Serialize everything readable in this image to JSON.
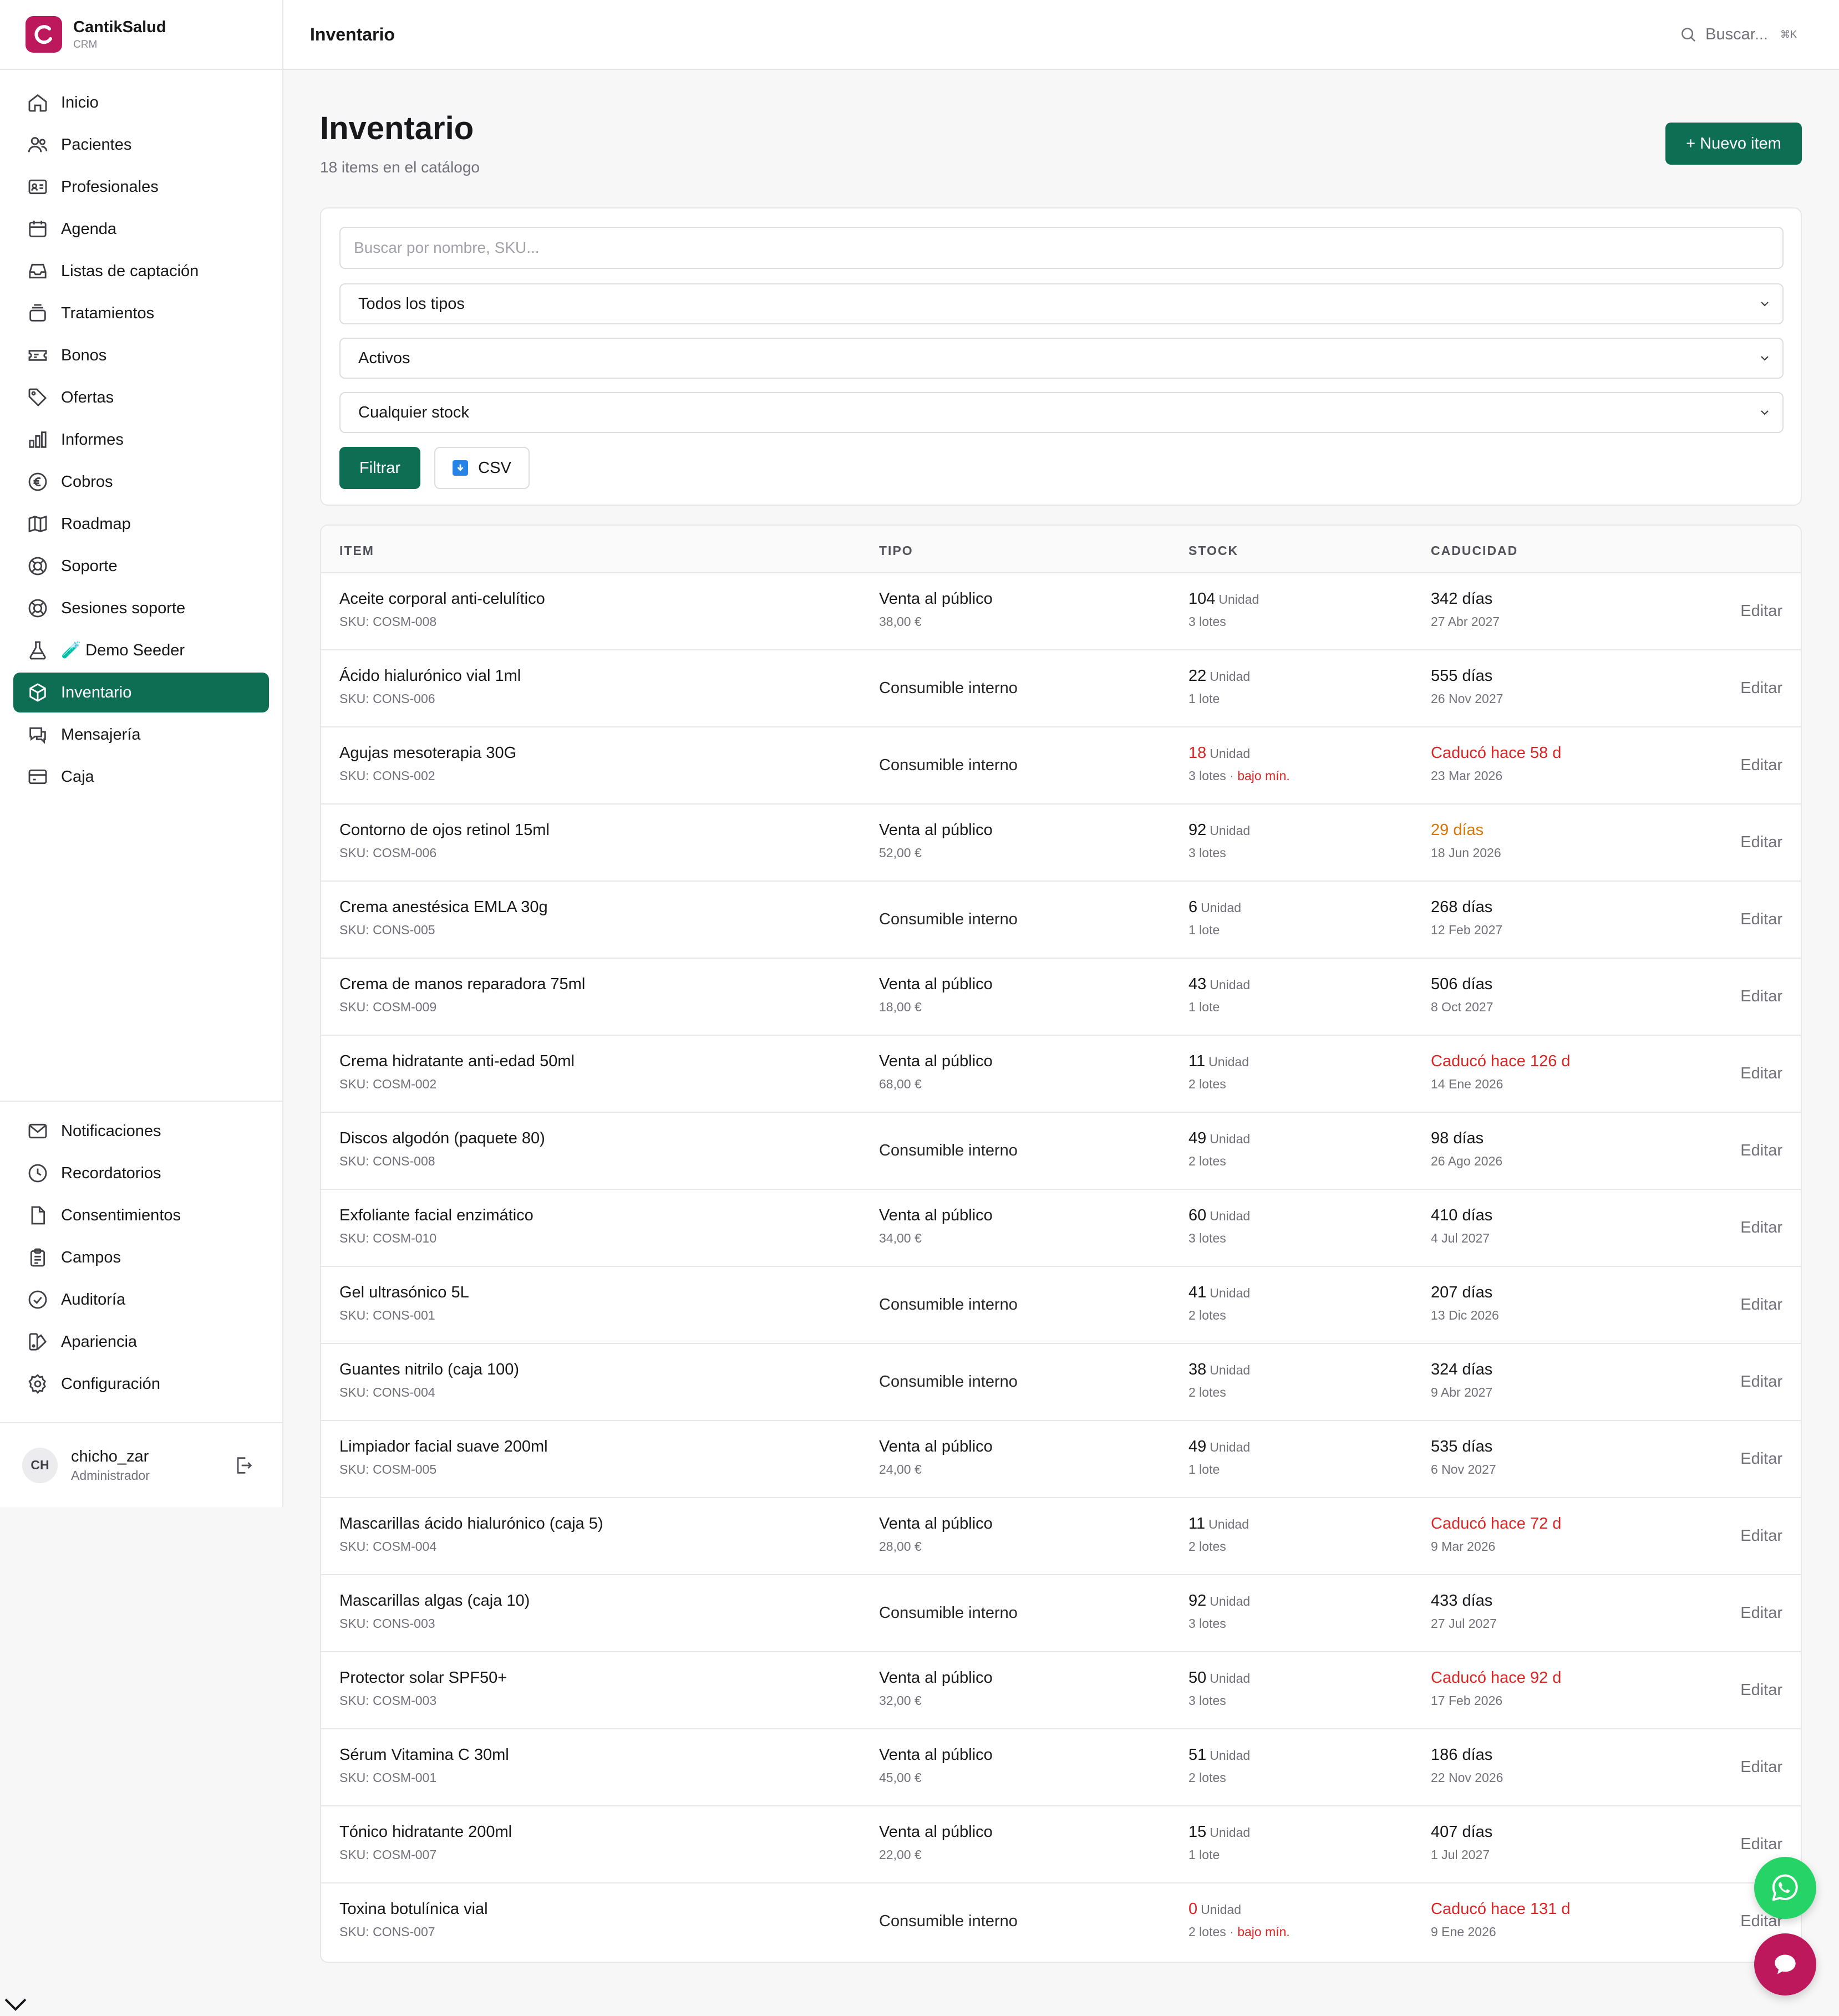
{
  "brand": {
    "name": "CantikSalud",
    "sub": "CRM"
  },
  "sidebar": {
    "items": [
      {
        "label": "Inicio",
        "icon": "home-icon"
      },
      {
        "label": "Pacientes",
        "icon": "users-icon"
      },
      {
        "label": "Profesionales",
        "icon": "id-card-icon"
      },
      {
        "label": "Agenda",
        "icon": "calendar-icon"
      },
      {
        "label": "Listas de captación",
        "icon": "inbox-icon"
      },
      {
        "label": "Tratamientos",
        "icon": "stack-icon"
      },
      {
        "label": "Bonos",
        "icon": "ticket-icon"
      },
      {
        "label": "Ofertas",
        "icon": "tag-icon"
      },
      {
        "label": "Informes",
        "icon": "bar-chart-icon"
      },
      {
        "label": "Cobros",
        "icon": "euro-icon"
      },
      {
        "label": "Roadmap",
        "icon": "map-icon"
      },
      {
        "label": "Soporte",
        "icon": "lifebuoy-icon"
      },
      {
        "label": "Sesiones soporte",
        "icon": "lifebuoy-icon"
      },
      {
        "label": "🧪 Demo Seeder",
        "icon": "flask-icon"
      },
      {
        "label": "Inventario",
        "icon": "box-icon",
        "active": true
      },
      {
        "label": "Mensajería",
        "icon": "chat-icon"
      },
      {
        "label": "Caja",
        "icon": "wallet-icon"
      }
    ],
    "bottom_items": [
      {
        "label": "Notificaciones",
        "icon": "mail-icon"
      },
      {
        "label": "Recordatorios",
        "icon": "clock-icon"
      },
      {
        "label": "Consentimientos",
        "icon": "file-icon"
      },
      {
        "label": "Campos",
        "icon": "clipboard-icon"
      },
      {
        "label": "Auditoría",
        "icon": "check-circle-icon"
      },
      {
        "label": "Apariencia",
        "icon": "palette-icon"
      },
      {
        "label": "Configuración",
        "icon": "gear-icon"
      }
    ],
    "user": {
      "initials": "CH",
      "name": "chicho_zar",
      "role": "Administrador"
    }
  },
  "topbar": {
    "title": "Inventario",
    "search_label": "Buscar...",
    "shortcut": "⌘K"
  },
  "page": {
    "title": "Inventario",
    "subtitle": "18 items en el catálogo",
    "new_button": "+ Nuevo item"
  },
  "filters": {
    "search_placeholder": "Buscar por nombre, SKU...",
    "type_select": "Todos los tipos",
    "status_select": "Activos",
    "stock_select": "Cualquier stock",
    "filter_button": "Filtrar",
    "csv_button": "CSV"
  },
  "table": {
    "headers": {
      "item": "ITEM",
      "tipo": "TIPO",
      "stock": "STOCK",
      "caducidad": "CADUCIDAD"
    },
    "edit_label": "Editar",
    "rows": [
      {
        "name": "Aceite corporal anti-celulítico",
        "sku": "SKU: COSM-008",
        "tipo": "Venta al público",
        "price": "38,00 €",
        "stock": "104",
        "unit": "Unidad",
        "lotes": "3 lotes",
        "low": "",
        "stock_status": "normal",
        "cad": "342 días",
        "cad_date": "27 Abr 2027",
        "cad_status": "normal"
      },
      {
        "name": "Ácido hialurónico vial 1ml",
        "sku": "SKU: CONS-006",
        "tipo": "Consumible interno",
        "price": "",
        "stock": "22",
        "unit": "Unidad",
        "lotes": "1 lote",
        "low": "",
        "stock_status": "normal",
        "cad": "555 días",
        "cad_date": "26 Nov 2027",
        "cad_status": "normal"
      },
      {
        "name": "Agujas mesoterapia 30G",
        "sku": "SKU: CONS-002",
        "tipo": "Consumible interno",
        "price": "",
        "stock": "18",
        "unit": "Unidad",
        "lotes": "3 lotes · ",
        "low": "bajo mín.",
        "stock_status": "low",
        "cad": "Caducó hace 58 d",
        "cad_date": "23 Mar 2026",
        "cad_status": "expired"
      },
      {
        "name": "Contorno de ojos retinol 15ml",
        "sku": "SKU: COSM-006",
        "tipo": "Venta al público",
        "price": "52,00 €",
        "stock": "92",
        "unit": "Unidad",
        "lotes": "3 lotes",
        "low": "",
        "stock_status": "normal",
        "cad": "29 días",
        "cad_date": "18 Jun 2026",
        "cad_status": "soon"
      },
      {
        "name": "Crema anestésica EMLA 30g",
        "sku": "SKU: CONS-005",
        "tipo": "Consumible interno",
        "price": "",
        "stock": "6",
        "unit": "Unidad",
        "lotes": "1 lote",
        "low": "",
        "stock_status": "normal",
        "cad": "268 días",
        "cad_date": "12 Feb 2027",
        "cad_status": "normal"
      },
      {
        "name": "Crema de manos reparadora 75ml",
        "sku": "SKU: COSM-009",
        "tipo": "Venta al público",
        "price": "18,00 €",
        "stock": "43",
        "unit": "Unidad",
        "lotes": "1 lote",
        "low": "",
        "stock_status": "normal",
        "cad": "506 días",
        "cad_date": "8 Oct 2027",
        "cad_status": "normal"
      },
      {
        "name": "Crema hidratante anti-edad 50ml",
        "sku": "SKU: COSM-002",
        "tipo": "Venta al público",
        "price": "68,00 €",
        "stock": "11",
        "unit": "Unidad",
        "lotes": "2 lotes",
        "low": "",
        "stock_status": "normal",
        "cad": "Caducó hace 126 d",
        "cad_date": "14 Ene 2026",
        "cad_status": "expired"
      },
      {
        "name": "Discos algodón (paquete 80)",
        "sku": "SKU: CONS-008",
        "tipo": "Consumible interno",
        "price": "",
        "stock": "49",
        "unit": "Unidad",
        "lotes": "2 lotes",
        "low": "",
        "stock_status": "normal",
        "cad": "98 días",
        "cad_date": "26 Ago 2026",
        "cad_status": "normal"
      },
      {
        "name": "Exfoliante facial enzimático",
        "sku": "SKU: COSM-010",
        "tipo": "Venta al público",
        "price": "34,00 €",
        "stock": "60",
        "unit": "Unidad",
        "lotes": "3 lotes",
        "low": "",
        "stock_status": "normal",
        "cad": "410 días",
        "cad_date": "4 Jul 2027",
        "cad_status": "normal"
      },
      {
        "name": "Gel ultrasónico 5L",
        "sku": "SKU: CONS-001",
        "tipo": "Consumible interno",
        "price": "",
        "stock": "41",
        "unit": "Unidad",
        "lotes": "2 lotes",
        "low": "",
        "stock_status": "normal",
        "cad": "207 días",
        "cad_date": "13 Dic 2026",
        "cad_status": "normal"
      },
      {
        "name": "Guantes nitrilo (caja 100)",
        "sku": "SKU: CONS-004",
        "tipo": "Consumible interno",
        "price": "",
        "stock": "38",
        "unit": "Unidad",
        "lotes": "2 lotes",
        "low": "",
        "stock_status": "normal",
        "cad": "324 días",
        "cad_date": "9 Abr 2027",
        "cad_status": "normal"
      },
      {
        "name": "Limpiador facial suave 200ml",
        "sku": "SKU: COSM-005",
        "tipo": "Venta al público",
        "price": "24,00 €",
        "stock": "49",
        "unit": "Unidad",
        "lotes": "1 lote",
        "low": "",
        "stock_status": "normal",
        "cad": "535 días",
        "cad_date": "6 Nov 2027",
        "cad_status": "normal"
      },
      {
        "name": "Mascarillas ácido hialurónico (caja 5)",
        "sku": "SKU: COSM-004",
        "tipo": "Venta al público",
        "price": "28,00 €",
        "stock": "11",
        "unit": "Unidad",
        "lotes": "2 lotes",
        "low": "",
        "stock_status": "normal",
        "cad": "Caducó hace 72 d",
        "cad_date": "9 Mar 2026",
        "cad_status": "expired"
      },
      {
        "name": "Mascarillas algas (caja 10)",
        "sku": "SKU: CONS-003",
        "tipo": "Consumible interno",
        "price": "",
        "stock": "92",
        "unit": "Unidad",
        "lotes": "3 lotes",
        "low": "",
        "stock_status": "normal",
        "cad": "433 días",
        "cad_date": "27 Jul 2027",
        "cad_status": "normal"
      },
      {
        "name": "Protector solar SPF50+",
        "sku": "SKU: COSM-003",
        "tipo": "Venta al público",
        "price": "32,00 €",
        "stock": "50",
        "unit": "Unidad",
        "lotes": "3 lotes",
        "low": "",
        "stock_status": "normal",
        "cad": "Caducó hace 92 d",
        "cad_date": "17 Feb 2026",
        "cad_status": "expired"
      },
      {
        "name": "Sérum Vitamina C 30ml",
        "sku": "SKU: COSM-001",
        "tipo": "Venta al público",
        "price": "45,00 €",
        "stock": "51",
        "unit": "Unidad",
        "lotes": "2 lotes",
        "low": "",
        "stock_status": "normal",
        "cad": "186 días",
        "cad_date": "22 Nov 2026",
        "cad_status": "normal"
      },
      {
        "name": "Tónico hidratante 200ml",
        "sku": "SKU: COSM-007",
        "tipo": "Venta al público",
        "price": "22,00 €",
        "stock": "15",
        "unit": "Unidad",
        "lotes": "1 lote",
        "low": "",
        "stock_status": "normal",
        "cad": "407 días",
        "cad_date": "1 Jul 2027",
        "cad_status": "normal"
      },
      {
        "name": "Toxina botulínica vial",
        "sku": "SKU: CONS-007",
        "tipo": "Consumible interno",
        "price": "",
        "stock": "0",
        "unit": "Unidad",
        "lotes": "2 lotes · ",
        "low": "bajo mín.",
        "stock_status": "low",
        "cad": "Caducó hace 131 d",
        "cad_date": "9 Ene 2026",
        "cad_status": "expired"
      }
    ]
  },
  "colors": {
    "primary": "#0e6e54",
    "brand": "#be185d",
    "danger": "#dc2626",
    "warning": "#d97706",
    "whatsapp": "#25d366"
  }
}
